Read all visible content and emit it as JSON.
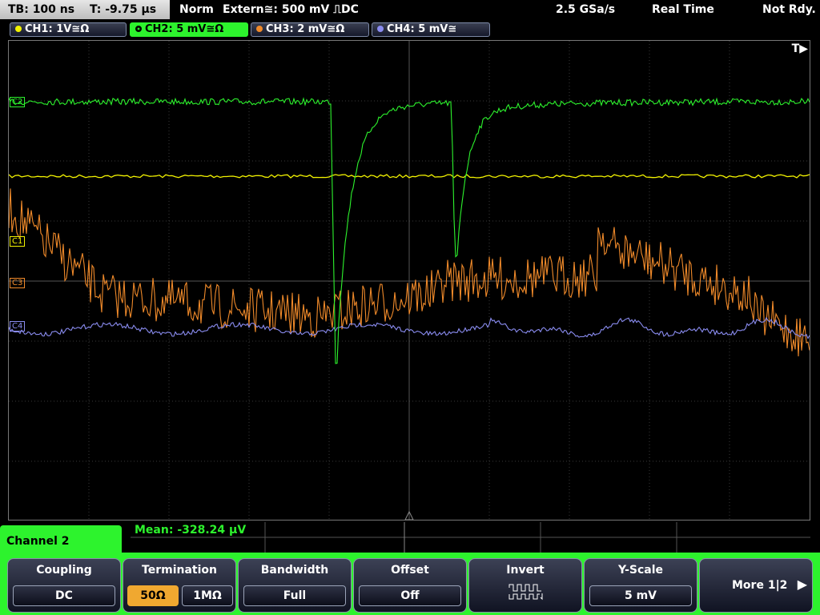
{
  "status_bar": {
    "timebase": "TB: 100 ns",
    "trigger_time": "T: -9.75 µs",
    "acq_mode": "Norm",
    "trigger_source": "Extern≅: 500 mV ⎍DC",
    "sample_rate": "2.5 GSa/s",
    "acq_type": "Real Time",
    "state": "Not Rdy."
  },
  "channels": [
    {
      "label": "CH1: 1V≅Ω",
      "color": "#f2f200",
      "active": false
    },
    {
      "label": "CH2: 5 mV≅Ω",
      "color": "#2df32d",
      "active": true
    },
    {
      "label": "CH3: 2 mV≅Ω",
      "color": "#f08a2a",
      "active": false
    },
    {
      "label": "CH4: 5 mV≅",
      "color": "#8a8cf0",
      "active": false
    }
  ],
  "markers": {
    "trigger": "T▶",
    "ch2": "C2",
    "ch1": "C1",
    "ch3": "C3",
    "ch4": "C4"
  },
  "measurement": {
    "mean": "Mean: -328.24 µV"
  },
  "menu": {
    "title": "Channel 2",
    "coupling": {
      "title": "Coupling",
      "value": "DC"
    },
    "termination": {
      "title": "Termination",
      "option_a": "50Ω",
      "option_b": "1MΩ",
      "selected": "50Ω"
    },
    "bandwidth": {
      "title": "Bandwidth",
      "value": "Full"
    },
    "offset": {
      "title": "Offset",
      "value": "Off"
    },
    "invert": {
      "title": "Invert"
    },
    "yscale": {
      "title": "Y-Scale",
      "value": "5 mV"
    },
    "more": {
      "label": "More 1|2"
    }
  }
}
